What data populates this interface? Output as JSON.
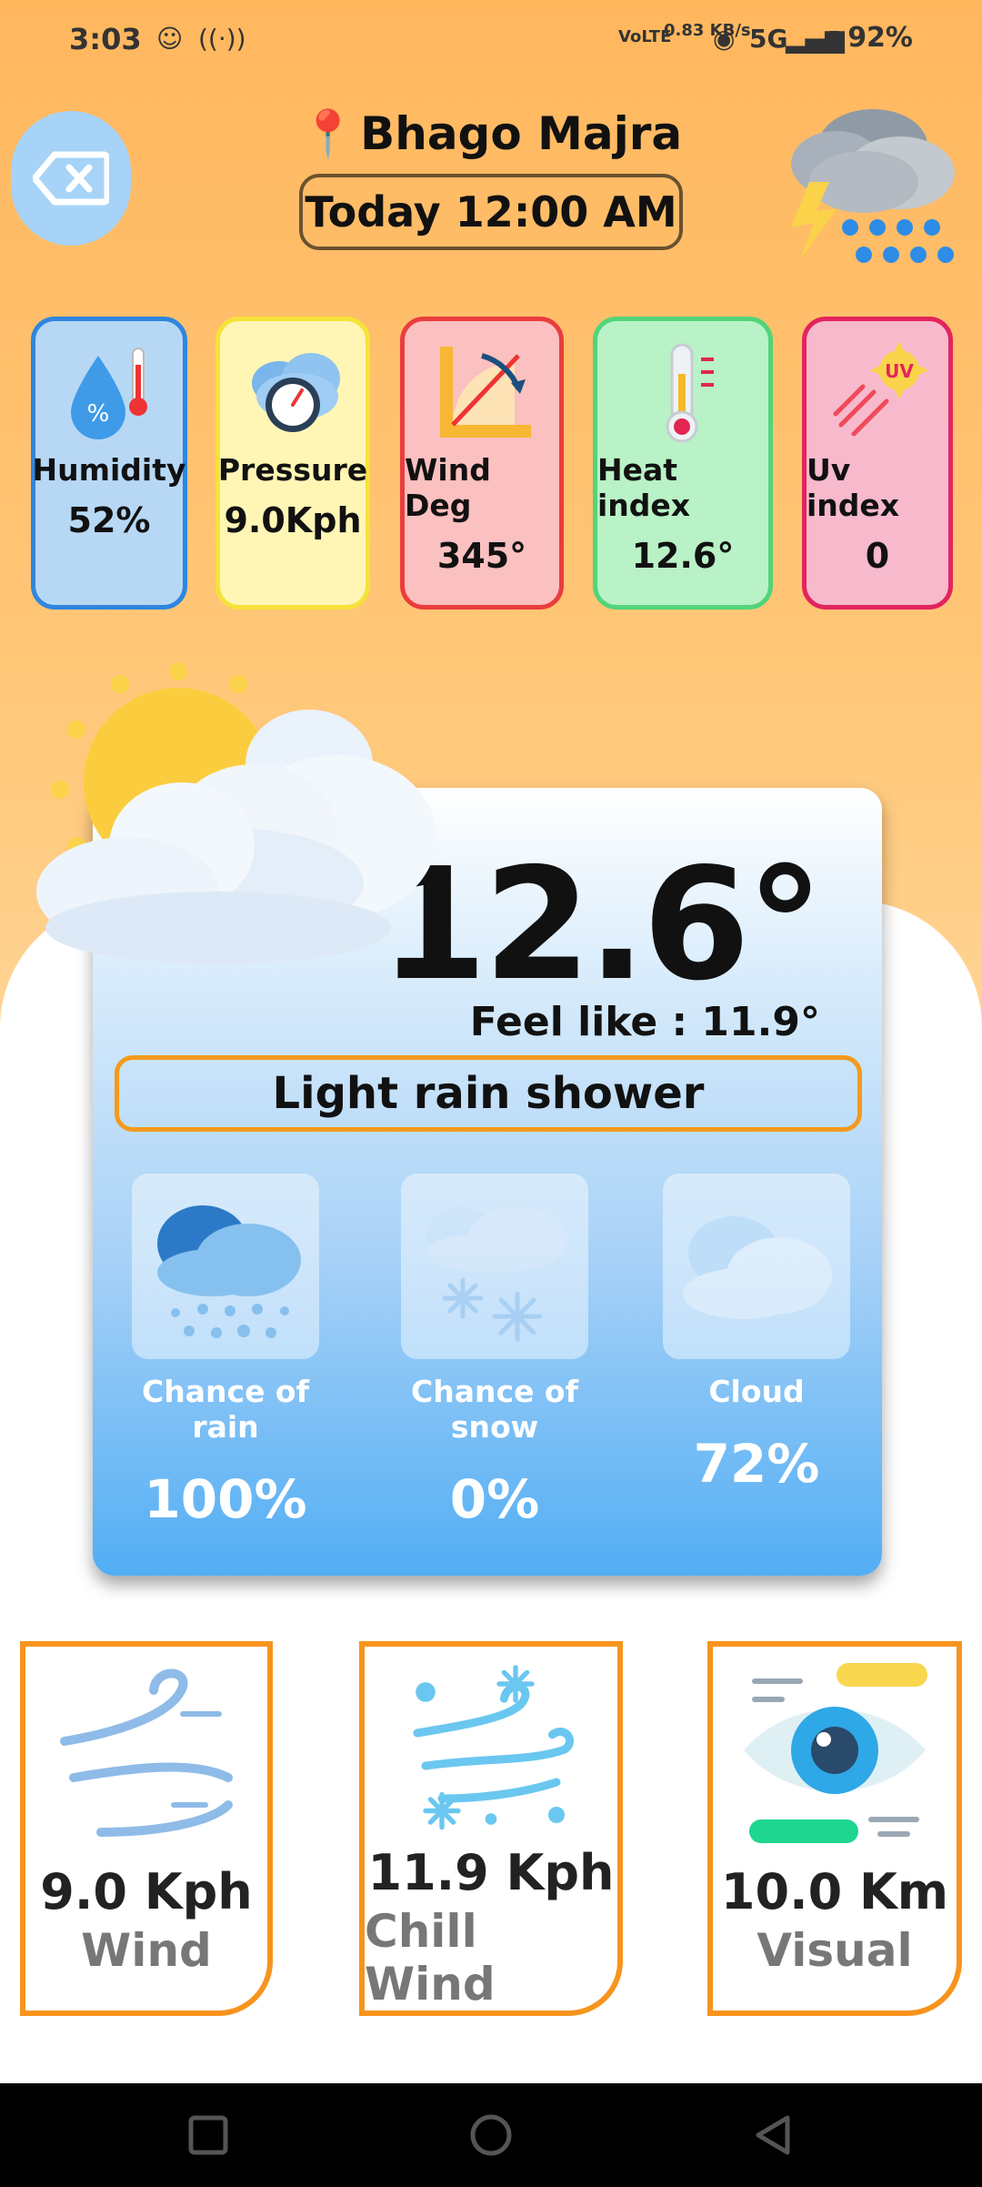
{
  "status_bar": {
    "time": "3:03",
    "network_speed": "0.83 KB/s",
    "network_type": "5G",
    "battery": "92%",
    "icons": [
      "face-icon",
      "hotspot-icon",
      "volte-icon",
      "wifi-icon",
      "signal-icon",
      "battery-icon"
    ]
  },
  "header": {
    "location": "Bhago Majra",
    "date": "Today 12:00 AM",
    "back_icon": "backspace-icon",
    "weather_icon": "thunderstorm-icon"
  },
  "stats": [
    {
      "title": "Humidity",
      "value": "52%",
      "icon": "humidity-icon",
      "bg": "#b7d8f5",
      "border": "#2f86df"
    },
    {
      "title": "Pressure",
      "value": "9.0Kph",
      "icon": "pressure-gauge-icon",
      "bg": "#fff6b5",
      "border": "#f5e23a"
    },
    {
      "title": "Wind Deg",
      "value": "345°",
      "icon": "wind-degree-icon",
      "bg": "#fbc0c0",
      "border": "#ea3d3d"
    },
    {
      "title": "Heat index",
      "value": "12.6°",
      "icon": "thermometer-icon",
      "bg": "#b9f2c6",
      "border": "#52d47a"
    },
    {
      "title": "Uv index",
      "value": "0",
      "icon": "uv-icon",
      "bg": "#f7b9cc",
      "border": "#e3245e"
    }
  ],
  "current": {
    "temperature": "12.6°",
    "feels_like": "Feel like : 11.9°",
    "condition": "Light rain shower",
    "icon": "partly-cloudy-sun-icon"
  },
  "metrics": [
    {
      "label": "Chance of rain",
      "value": "100%",
      "icon": "rain-cloud-icon"
    },
    {
      "label": "Chance of snow",
      "value": "0%",
      "icon": "snow-cloud-icon"
    },
    {
      "label": "Cloud",
      "value": "72%",
      "icon": "cloud-icon"
    }
  ],
  "bottom_cards": [
    {
      "value": "9.0 Kph",
      "label": "Wind",
      "icon": "wind-icon"
    },
    {
      "value": "11.9 Kph",
      "label": "Chill Wind",
      "icon": "chill-wind-icon"
    },
    {
      "value": "10.0 Km",
      "label": "Visual",
      "icon": "eye-icon"
    }
  ],
  "nav": {
    "icons": [
      "recents-icon",
      "home-icon",
      "back-icon"
    ]
  }
}
